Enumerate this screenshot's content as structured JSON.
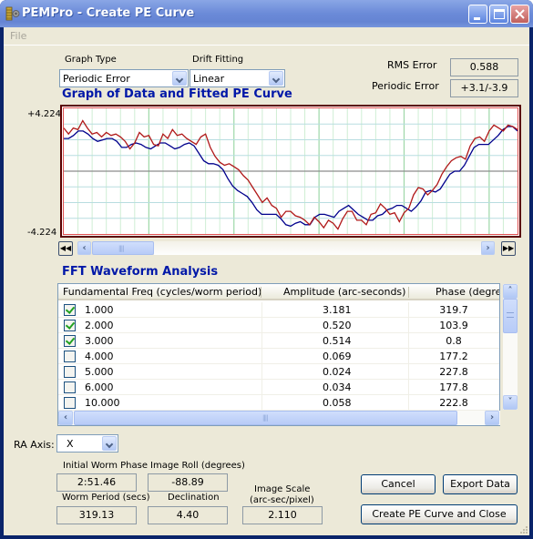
{
  "window": {
    "title": "PEMPro - Create PE Curve",
    "icon": "pempro-app-icon",
    "controls": [
      "minimize",
      "maximize",
      "close"
    ]
  },
  "menu": {
    "items": [
      {
        "label": "File"
      }
    ]
  },
  "controls": {
    "graph_type": {
      "label": "Graph Type",
      "value": "Periodic Error"
    },
    "drift_fitting": {
      "label": "Drift Fitting",
      "value": "Linear"
    },
    "rms_error": {
      "label": "RMS Error",
      "value": "0.588"
    },
    "periodic_error": {
      "label": "Periodic Error",
      "value": "+3.1/-3.9"
    }
  },
  "graph": {
    "title": "Graph of Data and Fitted PE Curve",
    "y_max_label": "+4.224",
    "y_min_label": "-4.224",
    "colors": {
      "data": "#b01818",
      "fit": "#00008c",
      "grid_minor": "#b8dde0",
      "grid_major": "#9ed8a8",
      "zero": "#8c8c8c"
    },
    "chart_data": {
      "type": "line",
      "title": "Graph of Data and Fitted PE Curve",
      "ylim": [
        -4.224,
        4.224
      ],
      "xlabel": "",
      "ylabel": "",
      "grid": true,
      "series": [
        {
          "name": "Data",
          "values": [
            2.9,
            2.5,
            2.9,
            2.8,
            3.4,
            2.9,
            2.5,
            2.6,
            2.3,
            2.6,
            2.4,
            2.5,
            2.3,
            2.0,
            1.5,
            1.9,
            2.6,
            2.3,
            2.4,
            1.8,
            1.7,
            2.5,
            2.2,
            2.8,
            2.4,
            2.5,
            2.2,
            2.0,
            1.8,
            2.3,
            2.5,
            1.6,
            1.0,
            0.6,
            0.4,
            0.5,
            0.3,
            0.1,
            -0.3,
            -0.6,
            -1.1,
            -1.6,
            -2.1,
            -1.8,
            -2.3,
            -2.5,
            -3.1,
            -2.7,
            -2.7,
            -3.0,
            -3.1,
            -3.3,
            -3.6,
            -3.1,
            -3.4,
            -3.8,
            -3.3,
            -3.5,
            -3.9,
            -3.2,
            -2.7,
            -2.7,
            -3.3,
            -3.3,
            -3.6,
            -2.9,
            -2.8,
            -2.2,
            -2.5,
            -2.9,
            -2.8,
            -3.4,
            -2.8,
            -2.5,
            -1.6,
            -1.1,
            -1.2,
            -1.6,
            -1.3,
            -0.9,
            -0.2,
            0.3,
            0.7,
            0.9,
            1.0,
            0.8,
            1.7,
            2.2,
            2.3,
            2.0,
            2.7,
            3.1,
            2.9,
            2.7,
            3.1,
            3.0,
            2.8
          ],
          "color": "#b01818"
        },
        {
          "name": "Fitted PE Curve",
          "values": [
            2.2,
            2.2,
            2.4,
            2.7,
            2.7,
            2.5,
            2.2,
            2.0,
            2.1,
            2.2,
            2.2,
            2.0,
            1.6,
            1.6,
            1.8,
            1.9,
            1.8,
            1.6,
            1.5,
            1.7,
            1.9,
            1.9,
            1.7,
            1.5,
            1.6,
            1.8,
            1.9,
            1.7,
            1.2,
            0.7,
            0.5,
            0.5,
            0.4,
            0.1,
            -0.5,
            -1.0,
            -1.3,
            -1.5,
            -1.7,
            -2.1,
            -2.6,
            -2.9,
            -2.9,
            -2.9,
            -2.9,
            -3.2,
            -3.6,
            -3.7,
            -3.5,
            -3.4,
            -3.6,
            -3.6,
            -3.1,
            -2.9,
            -2.9,
            -3.0,
            -3.1,
            -2.7,
            -2.5,
            -2.3,
            -2.6,
            -2.9,
            -3.1,
            -3.3,
            -3.3,
            -3.0,
            -2.9,
            -2.6,
            -2.5,
            -2.3,
            -2.3,
            -2.5,
            -2.7,
            -2.4,
            -2.0,
            -1.4,
            -1.3,
            -1.4,
            -1.2,
            -0.7,
            -0.2,
            0.0,
            0.0,
            0.4,
            1.0,
            1.6,
            1.8,
            1.8,
            1.8,
            2.1,
            2.4,
            2.8,
            3.0,
            3.0,
            2.7
          ],
          "color": "#00008c"
        }
      ]
    }
  },
  "fft": {
    "title": "FFT Waveform Analysis",
    "columns": [
      "Fundamental Freq (cycles/worm period)",
      "Amplitude (arc-seconds)",
      "Phase (degrees"
    ],
    "rows": [
      {
        "checked": true,
        "freq": "1.000",
        "amplitude": "3.181",
        "phase": "319.7"
      },
      {
        "checked": true,
        "freq": "2.000",
        "amplitude": "0.520",
        "phase": "103.9"
      },
      {
        "checked": true,
        "freq": "3.000",
        "amplitude": "0.514",
        "phase": "0.8"
      },
      {
        "checked": false,
        "freq": "4.000",
        "amplitude": "0.069",
        "phase": "177.2"
      },
      {
        "checked": false,
        "freq": "5.000",
        "amplitude": "0.024",
        "phase": "227.8"
      },
      {
        "checked": false,
        "freq": "6.000",
        "amplitude": "0.034",
        "phase": "177.8"
      },
      {
        "checked": false,
        "freq": "10.000",
        "amplitude": "0.058",
        "phase": "222.8"
      }
    ]
  },
  "ra_axis": {
    "label": "RA Axis:",
    "value": "X"
  },
  "info": {
    "initial_worm_phase": {
      "label": "Initial Worm Phase",
      "value": "2:51.46"
    },
    "image_roll": {
      "label": "Image Roll (degrees)",
      "value": "-88.89"
    },
    "worm_period": {
      "label": "Worm Period (secs)",
      "value": "319.13"
    },
    "declination": {
      "label": "Declination",
      "value": "4.40"
    },
    "image_scale": {
      "label_line1": "Image Scale",
      "label_line2": "(arc-sec/pixel)",
      "value": "2.110"
    }
  },
  "buttons": {
    "cancel": "Cancel",
    "export": "Export Data",
    "create": "Create PE Curve and Close"
  }
}
